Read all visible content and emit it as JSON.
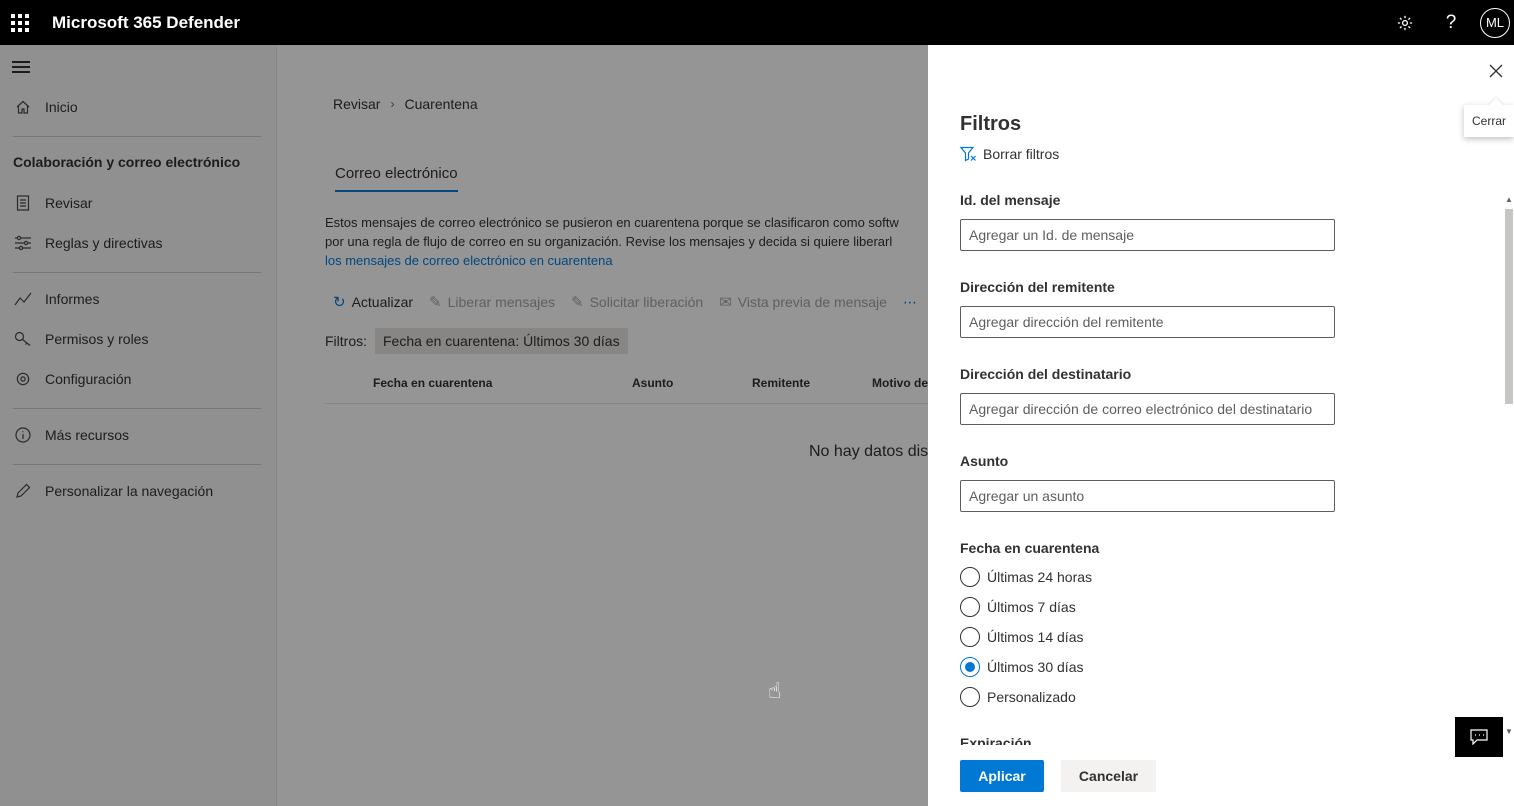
{
  "app": {
    "title": "Microsoft 365 Defender",
    "avatar_initials": "ML"
  },
  "topbar": {
    "settings_icon": "gear-icon",
    "help_icon": "?"
  },
  "nav": {
    "items": [
      {
        "label": "Inicio",
        "icon": "home-icon"
      },
      {
        "label": "Revisar",
        "icon": "review-icon"
      },
      {
        "label": "Reglas y directivas",
        "icon": "rules-icon"
      },
      {
        "label": "Informes",
        "icon": "chart-icon"
      },
      {
        "label": "Permisos y roles",
        "icon": "key-icon"
      },
      {
        "label": "Configuración",
        "icon": "gear-icon"
      },
      {
        "label": "Más recursos",
        "icon": "info-icon"
      },
      {
        "label": "Personalizar la navegación",
        "icon": "pencil-icon"
      }
    ],
    "section_title": "Colaboración y correo electrónico"
  },
  "main": {
    "breadcrumb": {
      "parent": "Revisar",
      "current": "Cuarentena"
    },
    "tab": "Correo electrónico",
    "description": {
      "line1": "Estos mensajes de correo electrónico se pusieron en cuarentena porque se clasificaron como softw",
      "line2": "por una regla de flujo de correo en su organización. Revise los mensajes y decida si quiere liberarl",
      "link": "los mensajes de correo electrónico en cuarentena"
    },
    "toolbar": {
      "refresh": "Actualizar",
      "release": "Liberar mensajes",
      "request_release": "Solicitar liberación",
      "preview": "Vista previa de mensaje",
      "more": "⋯"
    },
    "filters_label": "Filtros:",
    "filter_chip": "Fecha en cuarentena: Últimos 30 días",
    "columns": [
      "Fecha en cuarentena",
      "Asunto",
      "Remitente",
      "Motivo de"
    ],
    "no_data": "No hay datos dis"
  },
  "panel": {
    "title": "Filtros",
    "clear_filters": "Borrar filtros",
    "close_tooltip": "Cerrar",
    "fields": {
      "message_id": {
        "label": "Id. del mensaje",
        "placeholder": "Agregar un Id. de mensaje"
      },
      "sender": {
        "label": "Dirección del remitente",
        "placeholder": "Agregar dirección del remitente"
      },
      "recipient": {
        "label": "Dirección del destinatario",
        "placeholder": "Agregar dirección de correo electrónico del destinatario"
      },
      "subject": {
        "label": "Asunto",
        "placeholder": "Agregar un asunto"
      }
    },
    "date_group": {
      "label": "Fecha en cuarentena",
      "options": [
        "Últimas 24 horas",
        "Últimos 7 días",
        "Últimos 14 días",
        "Últimos 30 días",
        "Personalizado"
      ],
      "selected": "Últimos 30 días"
    },
    "next_section": "Expiración",
    "apply": "Aplicar",
    "cancel": "Cancelar"
  }
}
